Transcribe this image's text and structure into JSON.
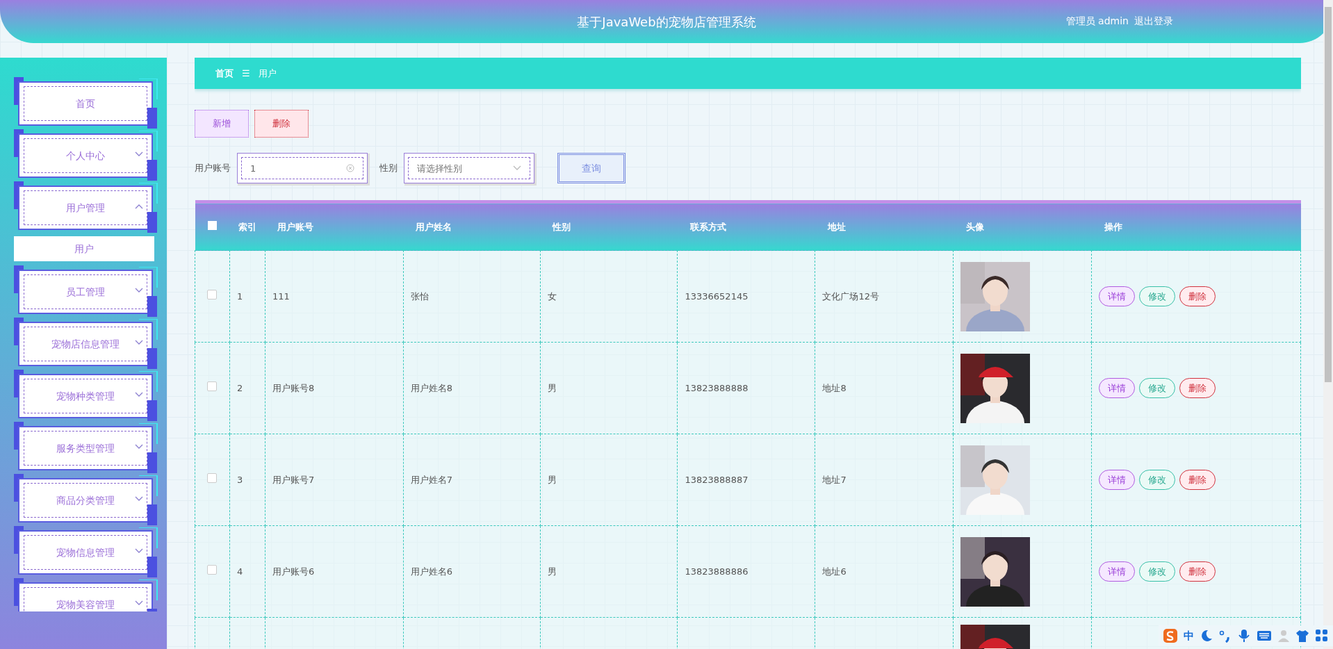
{
  "header": {
    "title": "基于JavaWeb的宠物店管理系统",
    "user": "管理员 admin",
    "logout": "退出登录"
  },
  "sidebar": {
    "items": [
      {
        "label": "首页",
        "kind": "link"
      },
      {
        "label": "个人中心",
        "kind": "group",
        "expanded": false
      },
      {
        "label": "用户管理",
        "kind": "group",
        "expanded": true,
        "children": [
          {
            "label": "用户"
          }
        ]
      },
      {
        "label": "员工管理",
        "kind": "group",
        "expanded": false
      },
      {
        "label": "宠物店信息管理",
        "kind": "group",
        "expanded": false
      },
      {
        "label": "宠物种类管理",
        "kind": "group",
        "expanded": false
      },
      {
        "label": "服务类型管理",
        "kind": "group",
        "expanded": false
      },
      {
        "label": "商品分类管理",
        "kind": "group",
        "expanded": false
      },
      {
        "label": "宠物信息管理",
        "kind": "group",
        "expanded": false
      },
      {
        "label": "宠物美容管理",
        "kind": "group",
        "expanded": false
      }
    ]
  },
  "breadcrumb": {
    "items": [
      "首页",
      "用户"
    ],
    "separator": "☰"
  },
  "actions": [
    {
      "label": "新增",
      "kind": "add"
    },
    {
      "label": "删除",
      "kind": "delete"
    }
  ],
  "search": {
    "account_label": "用户账号",
    "account_value": "1",
    "gender_label": "性别",
    "gender_placeholder": "请选择性别",
    "button": "查询"
  },
  "table": {
    "select_all_checked": false,
    "columns": [
      "索引",
      "用户账号",
      "用户姓名",
      "性别",
      "联系方式",
      "地址",
      "头像",
      "操作"
    ],
    "rows": [
      {
        "checked": false,
        "index": "1",
        "account": "111",
        "name": "张怡",
        "gender": "女",
        "phone": "13336652145",
        "address": "文化广场12号",
        "buttons": [
          "详情",
          "修改",
          "删除"
        ]
      },
      {
        "checked": false,
        "index": "2",
        "account": "用户账号8",
        "name": "用户姓名8",
        "gender": "男",
        "phone": "13823888888",
        "address": "地址8",
        "buttons": [
          "详情",
          "修改",
          "删除"
        ]
      },
      {
        "checked": false,
        "index": "3",
        "account": "用户账号7",
        "name": "用户姓名7",
        "gender": "男",
        "phone": "13823888887",
        "address": "地址7",
        "buttons": [
          "详情",
          "修改",
          "删除"
        ]
      },
      {
        "checked": false,
        "index": "4",
        "account": "用户账号6",
        "name": "用户姓名6",
        "gender": "男",
        "phone": "13823888886",
        "address": "地址6",
        "buttons": [
          "详情",
          "修改",
          "删除"
        ]
      }
    ]
  },
  "ime_toolbar": {
    "mode": "中"
  }
}
